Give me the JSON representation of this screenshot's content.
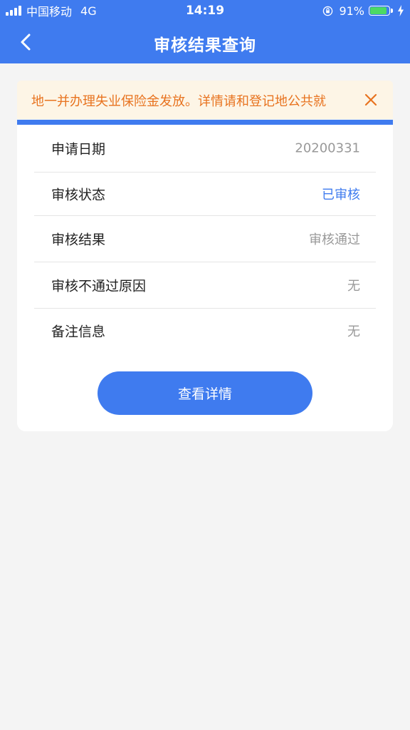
{
  "status_bar": {
    "carrier": "中国移动",
    "network": "4G",
    "time": "14:19",
    "battery_percent": "91%",
    "battery_level": 0.91,
    "battery_color": "#4cd964"
  },
  "nav": {
    "title": "审核结果查询",
    "back_icon": "chevron-left-icon"
  },
  "notice": {
    "text": "地一并办理失业保险金发放。详情请和登记地公共就",
    "text_color": "#e8731f",
    "background": "#fdf5e6",
    "close_icon": "close-icon"
  },
  "result": {
    "rows": [
      {
        "label": "申请日期",
        "value": "20200331"
      },
      {
        "label": "审核状态",
        "value": "已审核"
      },
      {
        "label": "审核结果",
        "value": "审核通过"
      },
      {
        "label": "审核不通过原因",
        "value": "无"
      },
      {
        "label": "备注信息",
        "value": "无"
      }
    ],
    "detail_button_label": "查看详情"
  },
  "colors": {
    "primary": "#3f7bef",
    "page_background": "#f4f4f4",
    "muted_text": "#999999"
  }
}
